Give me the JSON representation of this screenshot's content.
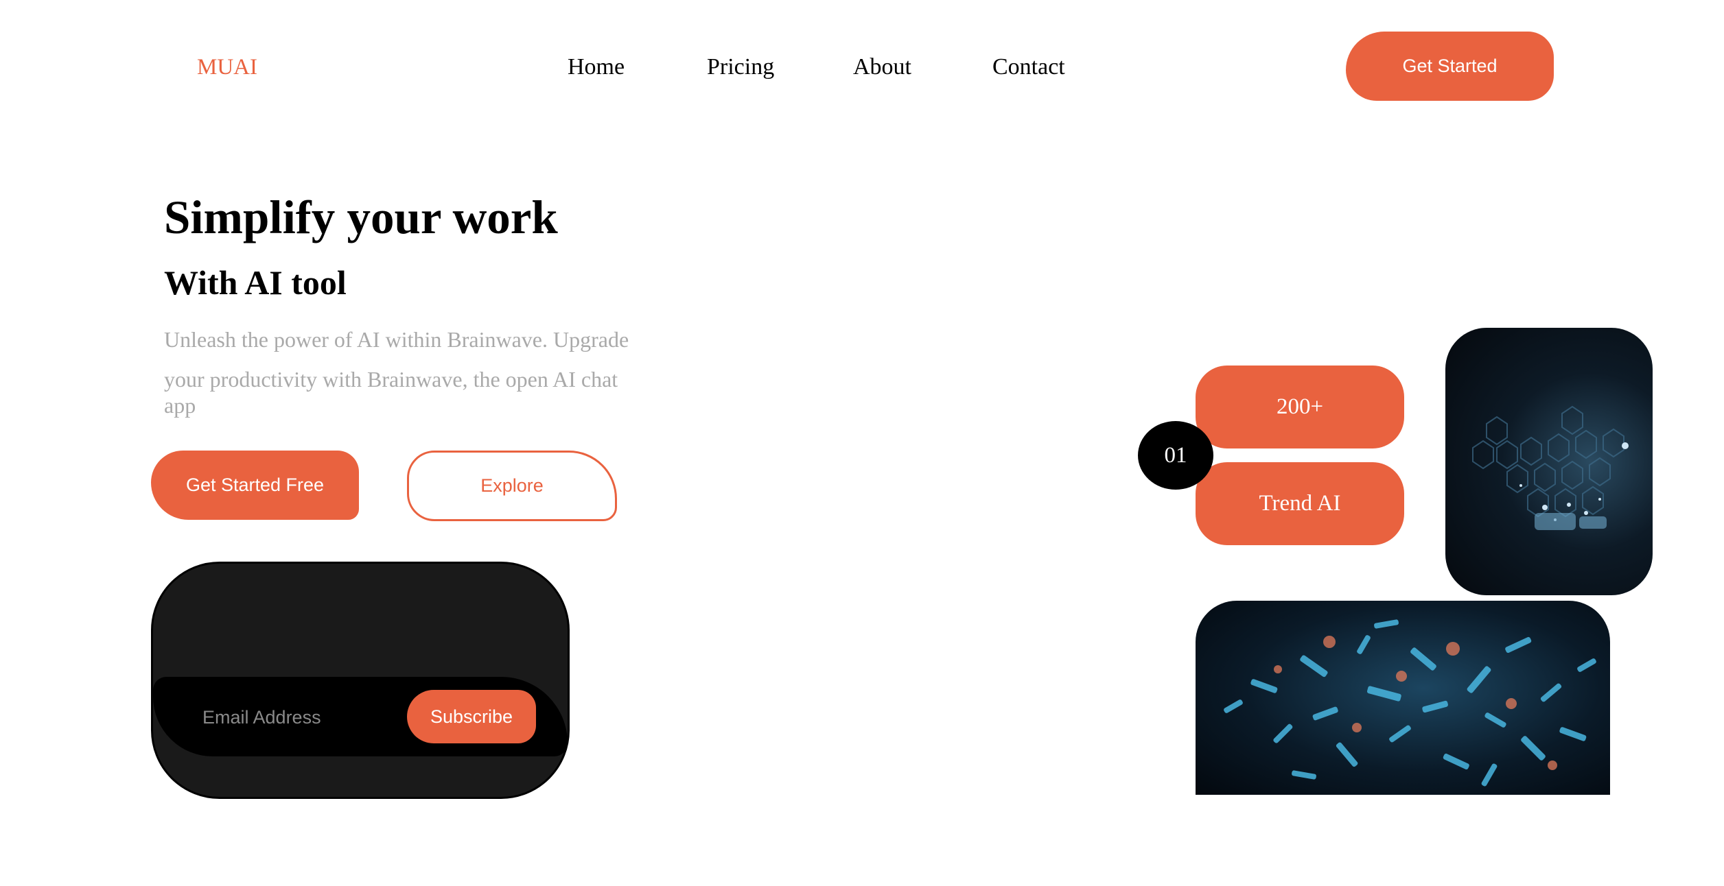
{
  "brand": {
    "logo": "MUAI",
    "accent_color": "#e9623f"
  },
  "nav": {
    "items": [
      {
        "label": "Home"
      },
      {
        "label": "Pricing"
      },
      {
        "label": "About"
      },
      {
        "label": "Contact"
      }
    ],
    "cta_label": "Get Started"
  },
  "hero": {
    "title": "Simplify your work",
    "subtitle": "With AI tool",
    "description_lines": [
      "Unleash the power of AI within Brainwave. Upgrade",
      "your productivity with Brainwave, the open AI chat",
      "app"
    ],
    "primary_cta": "Get Started Free",
    "secondary_cta": "Explore"
  },
  "subscribe": {
    "email_placeholder": "Email Address",
    "button_label": "Subscribe"
  },
  "stats": {
    "badge": "01",
    "count": "200+",
    "trend": "Trend AI"
  }
}
